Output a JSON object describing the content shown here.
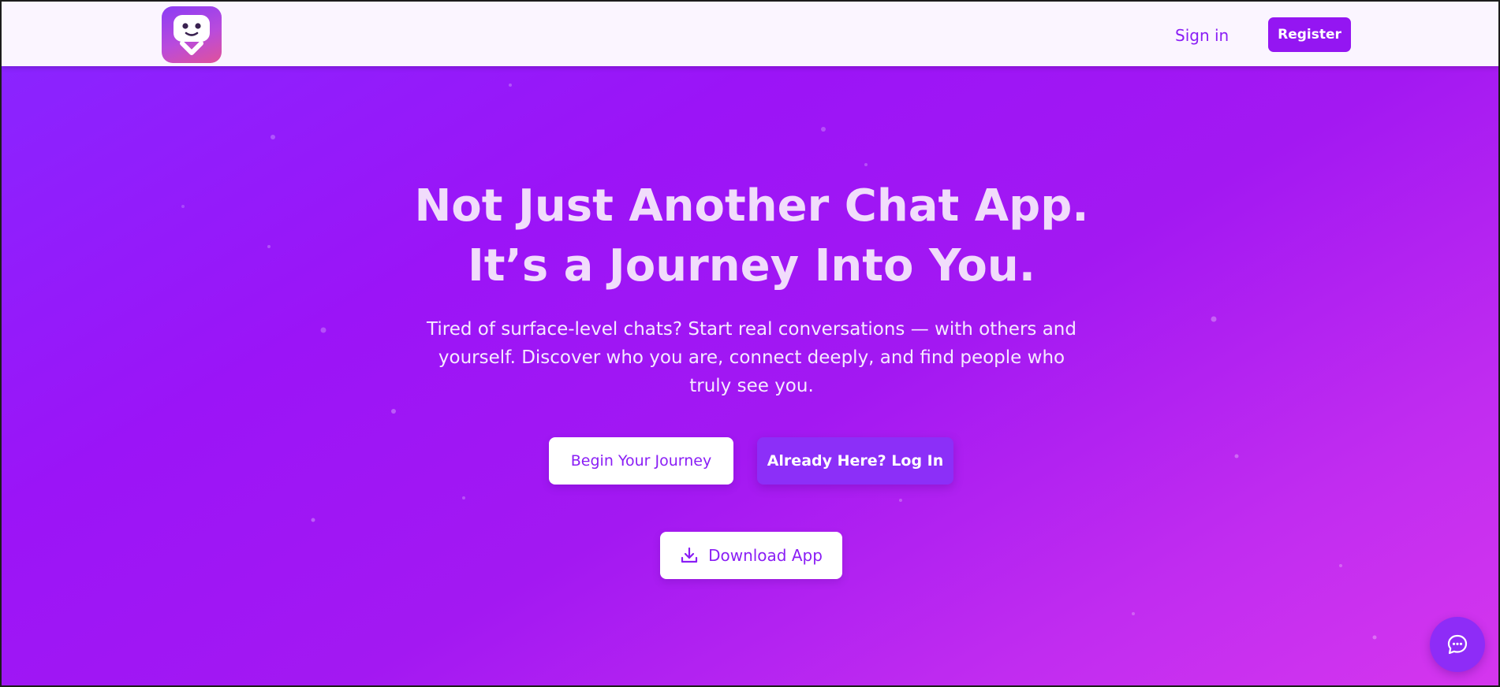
{
  "header": {
    "logo_icon": "smiling-chat-bubble-icon",
    "signin_label": "Sign in",
    "register_label": "Register"
  },
  "hero": {
    "headline_line1": "Not Just Another Chat App.",
    "headline_line2": "It’s a Journey Into You.",
    "subtext": "Tired of surface-level chats? Start real conversations — with others and yourself. Discover who you are, connect deeply, and find people who truly see you.",
    "primary_button": "Begin Your Journey",
    "secondary_button": "Already Here? Log In",
    "download_button": "Download App",
    "download_icon": "download-icon"
  },
  "chat_widget": {
    "icon": "chat-bubble-icon"
  },
  "colors": {
    "accent": "#9416f2",
    "hero_gradient_start": "#8a24ff",
    "hero_gradient_end": "#d536ee",
    "header_bg": "#fbf5ff",
    "headline": "#f1dcfb"
  }
}
